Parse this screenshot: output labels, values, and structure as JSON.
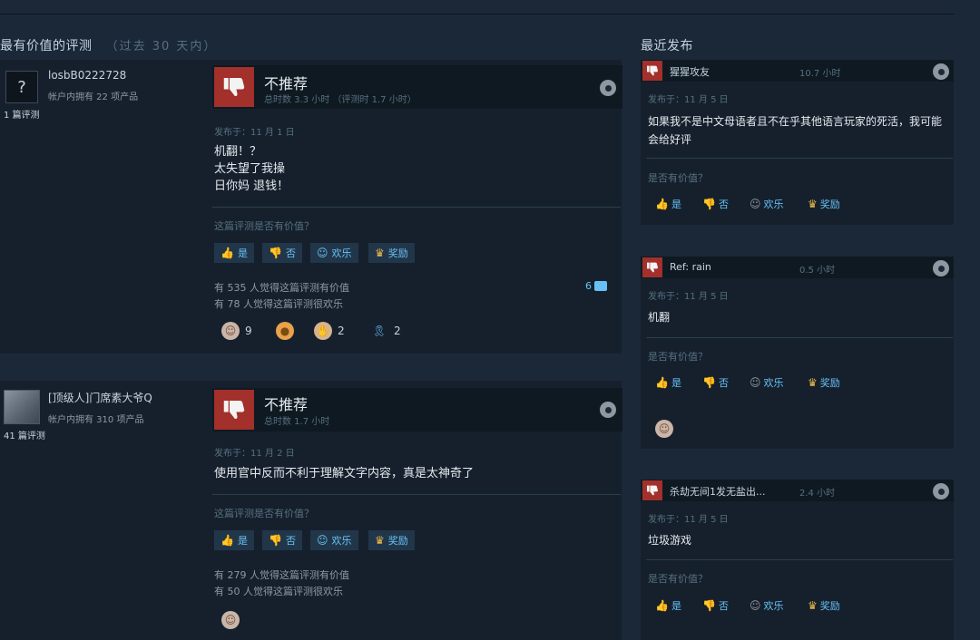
{
  "left": {
    "title": "最有价值的评测",
    "subtitle": "（过去 30 天内）",
    "reviews": [
      {
        "avatar_text": "?",
        "username": "losbB0222728",
        "owned": "帐户内拥有 22 项产品",
        "review_count": "1 篇评测",
        "verdict": "不推荐",
        "hours": "总时数 3.3 小时  （评测时 1.7 小时）",
        "posted": "发布于：11 月 1 日",
        "lines": [
          "机翻！？",
          "太失望了我操",
          "日你妈 退钱！"
        ],
        "helpful_q": "这篇评测是否有价值？",
        "btn_yes": "是",
        "btn_no": "否",
        "btn_fun": "欢乐",
        "btn_award": "奖励",
        "helpful_stat": "有 535 人觉得这篇评测有价值",
        "funny_stat": "有 78 人觉得这篇评测很欢乐",
        "comments": "6",
        "awards": [
          {
            "icon": "clown-award-icon",
            "count": "9"
          },
          {
            "icon": "cookie-award-icon",
            "count": ""
          },
          {
            "icon": "hands-award-icon",
            "count": "2"
          },
          {
            "icon": "ribbon-award-icon",
            "count": "2"
          }
        ]
      },
      {
        "username": "[顶级人]门席素大爷Q",
        "owned": "帐户内拥有 310 项产品",
        "review_count": "41 篇评测",
        "verdict": "不推荐",
        "hours": "总时数 1.7 小时",
        "posted": "发布于：11 月 2 日",
        "lines": [
          "使用官中反而不利于理解文字内容，真是太神奇了"
        ],
        "helpful_q": "这篇评测是否有价值？",
        "btn_yes": "是",
        "btn_no": "否",
        "btn_fun": "欢乐",
        "btn_award": "奖励",
        "helpful_stat": "有 279 人觉得这篇评测有价值",
        "funny_stat": "有 50 人觉得这篇评测很欢乐"
      }
    ]
  },
  "right": {
    "title": "最近发布",
    "reviews": [
      {
        "name": "猩猩攻友",
        "hours": "10.7 小时",
        "posted": "发布于：11 月 5 日",
        "text": "如果我不是中文母语者且不在乎其他语言玩家的死活，我可能会给好评",
        "helpful_q": "是否有价值？",
        "btn_yes": "是",
        "btn_no": "否",
        "btn_fun": "欢乐",
        "btn_award": "奖励"
      },
      {
        "name": "Ref: rain",
        "hours": "0.5 小时",
        "posted": "发布于：11 月 5 日",
        "text": "机翻",
        "helpful_q": "是否有价值？",
        "btn_yes": "是",
        "btn_no": "否",
        "btn_fun": "欢乐",
        "btn_award": "奖励"
      },
      {
        "name": "杀劫无间1发无盐出...",
        "hours": "2.4 小时",
        "posted": "发布于：11 月 5 日",
        "text": "垃圾游戏",
        "helpful_q": "是否有价值？",
        "btn_yes": "是",
        "btn_no": "否",
        "btn_fun": "欢乐",
        "btn_award": "奖励"
      }
    ]
  },
  "colors": {
    "background": "#1b2838",
    "thumb_down": "#a3302b",
    "link_blue": "#66c0f4",
    "award_gold": "#e9b94a"
  }
}
